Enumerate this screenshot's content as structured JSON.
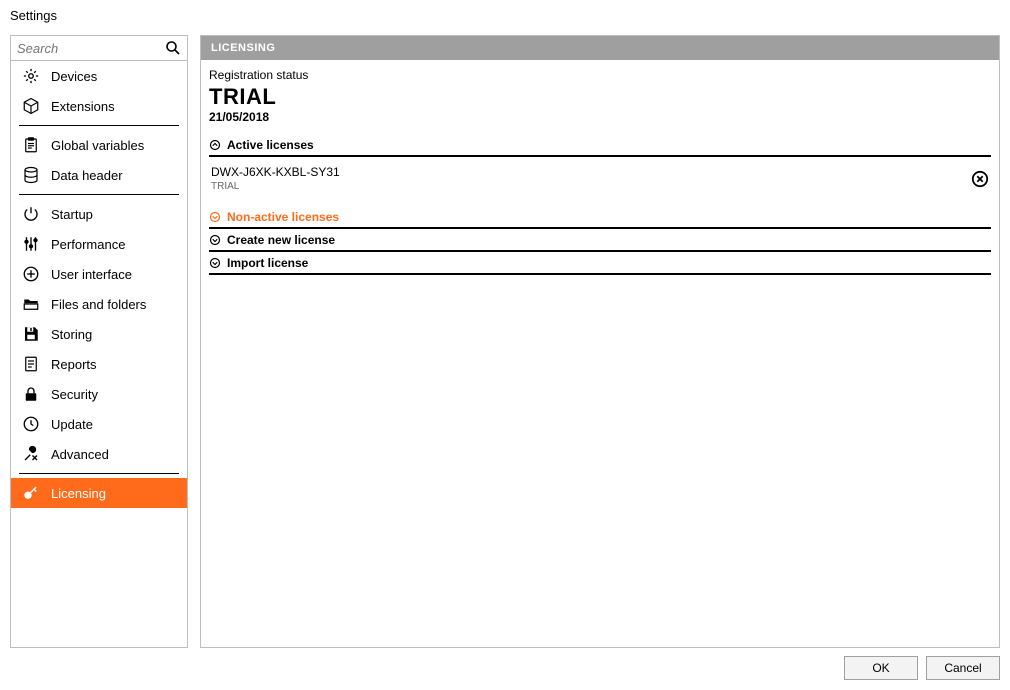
{
  "window": {
    "title": "Settings"
  },
  "sidebar": {
    "search_placeholder": "Search",
    "groups": [
      {
        "items": [
          "Devices",
          "Extensions"
        ]
      },
      {
        "items": [
          "Global variables",
          "Data header"
        ]
      },
      {
        "items": [
          "Startup",
          "Performance",
          "User interface",
          "Files and folders",
          "Storing",
          "Reports",
          "Security",
          "Update",
          "Advanced"
        ]
      },
      {
        "items": [
          "Licensing"
        ]
      }
    ],
    "selected": "Licensing"
  },
  "content": {
    "header": "LICENSING",
    "registration": {
      "label": "Registration status",
      "value": "TRIAL",
      "date": "21/05/2018"
    },
    "sections": {
      "active": {
        "title": "Active licenses",
        "expanded": true,
        "licenses": [
          {
            "key": "DWX-J6XK-KXBL-SY31",
            "tag": "TRIAL"
          }
        ]
      },
      "nonactive": {
        "title": "Non-active licenses",
        "expanded": false
      },
      "create": {
        "title": "Create new license",
        "expanded": false
      },
      "import": {
        "title": "Import license",
        "expanded": false
      }
    }
  },
  "footer": {
    "ok": "OK",
    "cancel": "Cancel"
  },
  "colors": {
    "accent": "#ff6b1a"
  }
}
